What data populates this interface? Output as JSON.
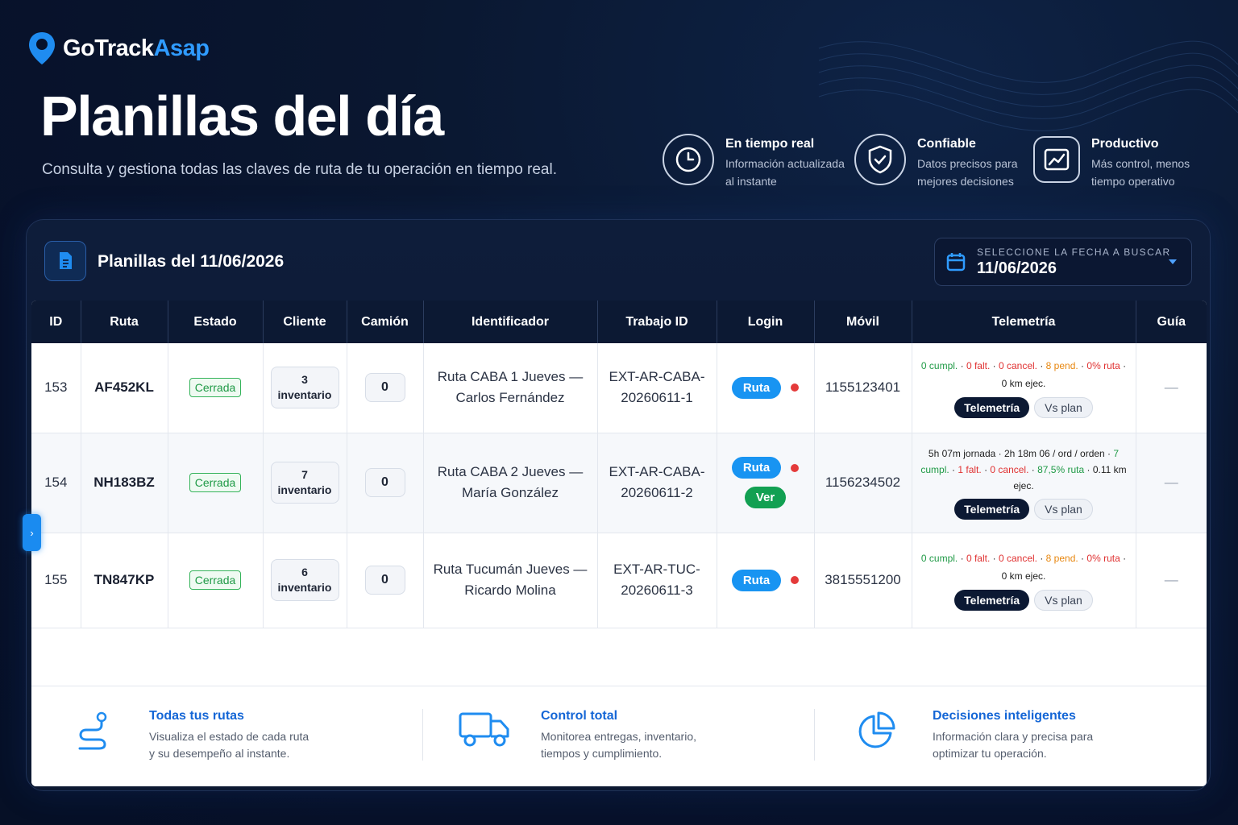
{
  "brand": {
    "name_part1": "GoTrack",
    "name_part2": "Asap"
  },
  "hero": {
    "title": "Planillas del día",
    "subtitle": "Consulta y gestiona todas las claves de ruta de tu operación en tiempo real."
  },
  "features": [
    {
      "icon": "clock-icon",
      "title": "En tiempo real",
      "desc1": "Información actualizada",
      "desc2": "al instante"
    },
    {
      "icon": "shield-check-icon",
      "title": "Confiable",
      "desc1": "Datos precisos para",
      "desc2": "mejores decisiones"
    },
    {
      "icon": "chart-trend-icon",
      "title": "Productivo",
      "desc1": "Más control, menos",
      "desc2": "tiempo operativo"
    }
  ],
  "panel": {
    "title": "Planillas del 11/06/2026",
    "date_label": "SELECCIONE LA FECHA A BUSCAR",
    "date_value": "11/06/2026"
  },
  "table": {
    "headers": [
      "ID",
      "Ruta",
      "Estado",
      "Cliente",
      "Camión",
      "Identificador",
      "Trabajo ID",
      "Login",
      "Móvil",
      "Telemetría",
      "Guía"
    ],
    "rows": [
      {
        "id": "153",
        "route": "AF452KL",
        "status": "Cerrada",
        "client_count": "3",
        "client_label": "inventario",
        "truck": "0",
        "ident1": "Ruta CABA 1 Jueves —",
        "ident2": "Carlos Fernández",
        "job1": "EXT-AR-CABA-",
        "job2": "20260611-1",
        "login": "Ruta",
        "mobile": "1155123401",
        "tele": {
          "a": "0 cumpl.",
          "b": "0 falt.",
          "c": "0 cancel.",
          "d": "8 pend.",
          "e": "0% ruta",
          "f": "0 km ejec."
        },
        "guide": "—"
      },
      {
        "id": "154",
        "route": "NH183BZ",
        "status": "Cerrada",
        "client_count": "7",
        "client_label": "inventario",
        "truck": "0",
        "ident1": "Ruta CABA 2 Jueves —",
        "ident2": "María González",
        "job1": "EXT-AR-CABA-",
        "job2": "20260611-2",
        "login": "Ruta",
        "login2": "Ver",
        "mobile": "1156234502",
        "tele": {
          "a": "5h 07m jornada",
          "b": "2h 18m 06 / ord / orden",
          "c": "7 cumpl.",
          "d": "1 falt.",
          "e": "0 cancel.",
          "f": "87,5% ruta",
          "g": "0.11 km ejec."
        },
        "guide": "—"
      },
      {
        "id": "155",
        "route": "TN847KP",
        "status": "Cerrada",
        "client_count": "6",
        "client_label": "inventario",
        "truck": "0",
        "ident1": "Ruta Tucumán Jueves —",
        "ident2": "Ricardo Molina",
        "job1": "EXT-AR-TUC-",
        "job2": "20260611-3",
        "login": "Ruta",
        "mobile": "3815551200",
        "tele": {
          "a": "0 cumpl.",
          "b": "0 falt.",
          "c": "0 cancel.",
          "d": "8 pend.",
          "e": "0% ruta",
          "f": "0 km ejec."
        },
        "guide": "—"
      }
    ],
    "btn_telemetry": "Telemetría",
    "btn_vsplan": "Vs plan"
  },
  "bottom": [
    {
      "icon": "route-icon",
      "title": "Todas tus rutas",
      "desc1": "Visualiza el estado de cada ruta",
      "desc2": "y su desempeño al instante."
    },
    {
      "icon": "truck-icon",
      "title": "Control total",
      "desc1": "Monitorea entregas, inventario,",
      "desc2": "tiempos y cumplimiento."
    },
    {
      "icon": "pie-chart-icon",
      "title": "Decisiones inteligentes",
      "desc1": "Información clara y precisa para",
      "desc2": "optimizar tu operación."
    }
  ],
  "colors": {
    "accent": "#1894f2",
    "dark": "#0c1933",
    "green": "#1f9a46",
    "red": "#e03131",
    "orange": "#e8870f"
  }
}
